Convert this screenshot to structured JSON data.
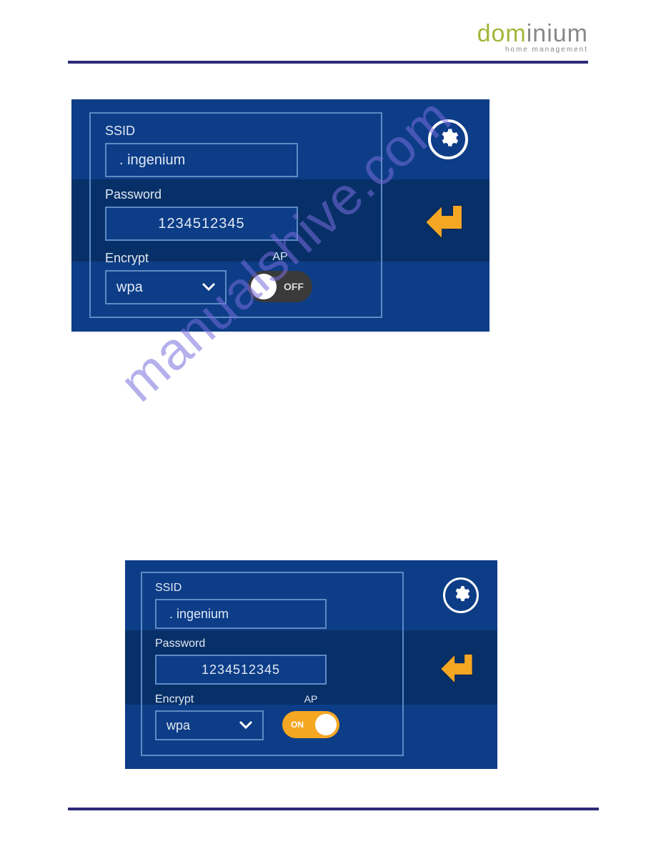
{
  "logo": {
    "part1": "dom",
    "part2": "inium",
    "tagline": "home management"
  },
  "watermark": "manualshive.com",
  "panel1": {
    "ssid": {
      "label": "SSID",
      "value": ". ingenium"
    },
    "password": {
      "label": "Password",
      "value": "1234512345"
    },
    "encrypt": {
      "label": "Encrypt",
      "value": "wpa"
    },
    "ap": {
      "label": "AP",
      "state": "OFF"
    }
  },
  "panel2": {
    "ssid": {
      "label": "SSID",
      "value": ". ingenium"
    },
    "password": {
      "label": "Password",
      "value": "1234512345"
    },
    "encrypt": {
      "label": "Encrypt",
      "value": "wpa"
    },
    "ap": {
      "label": "AP",
      "state": "ON"
    }
  }
}
